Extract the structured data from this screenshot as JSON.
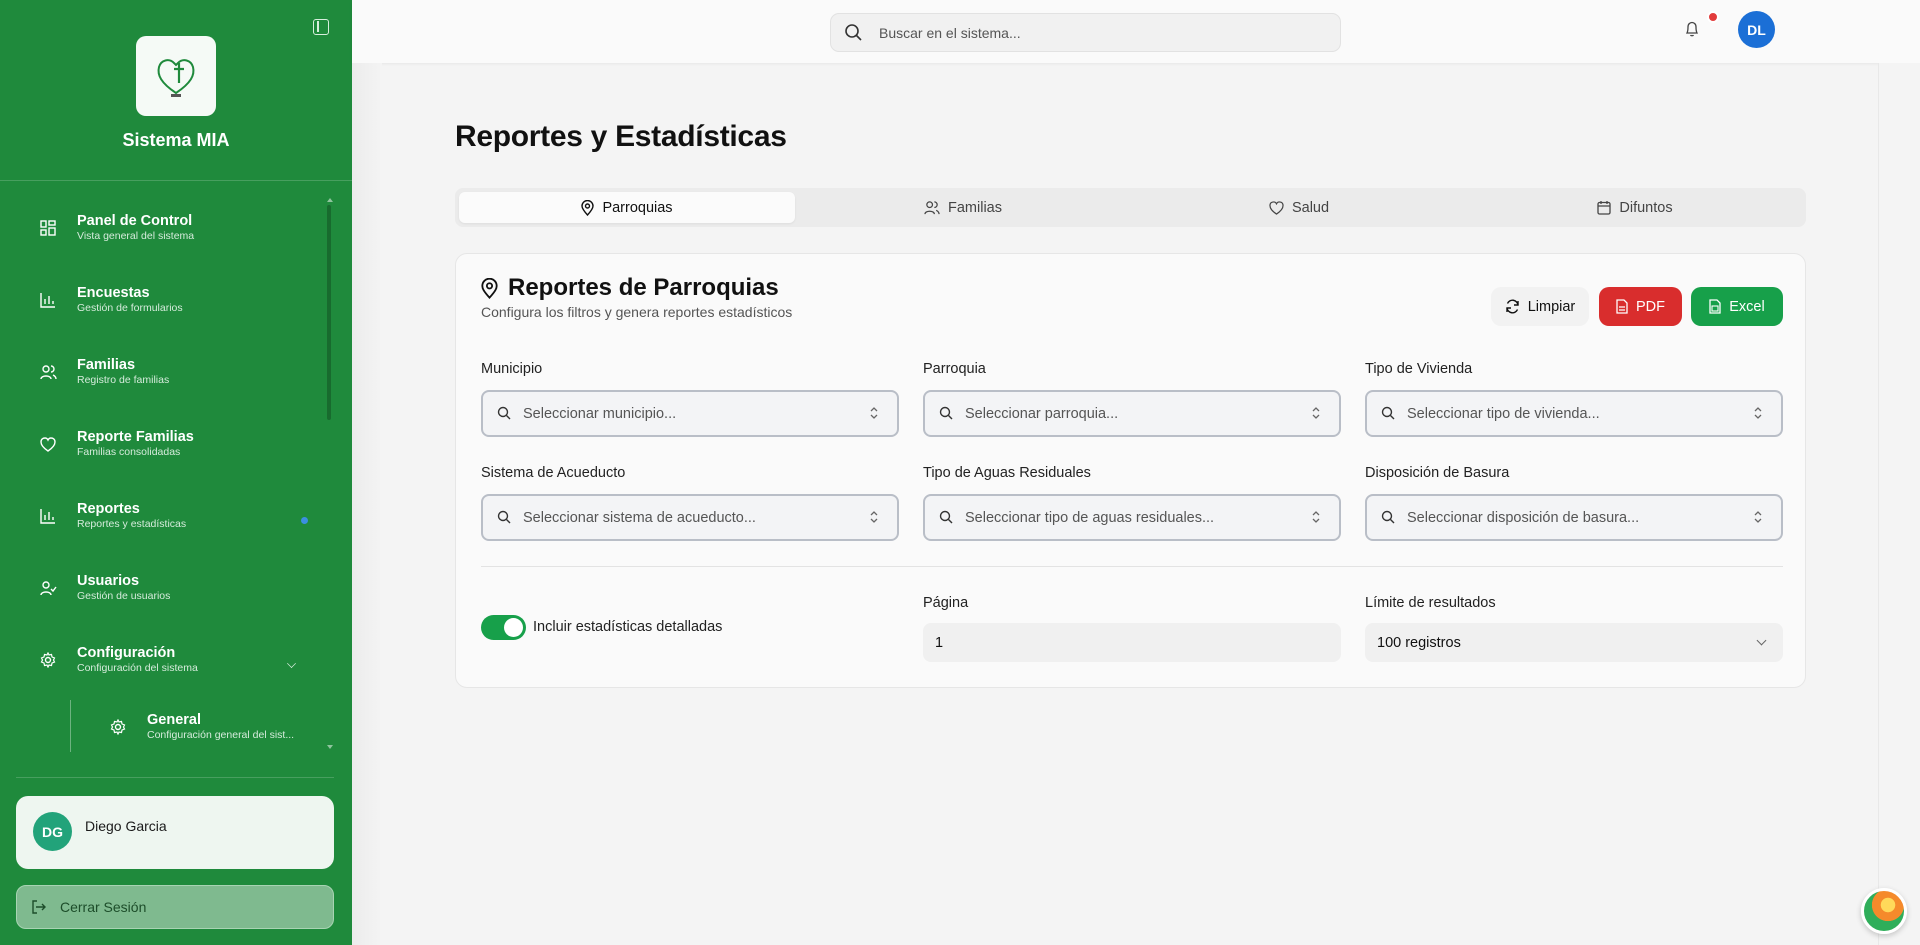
{
  "app": {
    "brand": "Sistema MIA"
  },
  "sidebar": {
    "items": [
      {
        "label": "Panel de Control",
        "sub": "Vista general del sistema",
        "icon": "dashboard-icon"
      },
      {
        "label": "Encuestas",
        "sub": "Gestión de formularios",
        "icon": "bar-chart-icon"
      },
      {
        "label": "Familias",
        "sub": "Registro de familias",
        "icon": "users-icon"
      },
      {
        "label": "Reporte Familias",
        "sub": "Familias consolidadas",
        "icon": "heart-icon"
      },
      {
        "label": "Reportes",
        "sub": "Reportes y estadísticas",
        "icon": "bar-chart-icon"
      },
      {
        "label": "Usuarios",
        "sub": "Gestión de usuarios",
        "icon": "user-check-icon"
      },
      {
        "label": "Configuración",
        "sub": "Configuración del sistema",
        "icon": "gear-icon"
      }
    ],
    "subitem": {
      "label": "General",
      "sub": "Configuración general del sist...",
      "icon": "gear-icon"
    },
    "user": {
      "initials": "DG",
      "name": "Diego Garcia"
    },
    "logout_label": "Cerrar Sesión"
  },
  "topbar": {
    "search_placeholder": "Buscar en el sistema...",
    "avatar_initials": "DL"
  },
  "main": {
    "title": "Reportes y Estadísticas",
    "tabs": [
      {
        "label": "Parroquias",
        "icon": "map-pin-icon"
      },
      {
        "label": "Familias",
        "icon": "users-icon"
      },
      {
        "label": "Salud",
        "icon": "heart-icon"
      },
      {
        "label": "Difuntos",
        "icon": "calendar-icon"
      }
    ],
    "card": {
      "title": "Reportes de Parroquias",
      "subtitle": "Configura los filtros y genera reportes estadísticos",
      "buttons": {
        "clear": "Limpiar",
        "pdf": "PDF",
        "excel": "Excel"
      },
      "filters": [
        {
          "label": "Municipio",
          "placeholder": "Seleccionar municipio..."
        },
        {
          "label": "Parroquia",
          "placeholder": "Seleccionar parroquia..."
        },
        {
          "label": "Tipo de Vivienda",
          "placeholder": "Seleccionar tipo de vivienda..."
        },
        {
          "label": "Sistema de Acueducto",
          "placeholder": "Seleccionar sistema de acueducto..."
        },
        {
          "label": "Tipo de Aguas Residuales",
          "placeholder": "Seleccionar tipo de aguas residuales..."
        },
        {
          "label": "Disposición de Basura",
          "placeholder": "Seleccionar disposición de basura..."
        }
      ],
      "toggle_label": "Incluir estadísticas detalladas",
      "toggle_on": true,
      "page_label": "Página",
      "page_value": "1",
      "limit_label": "Límite de resultados",
      "limit_value": "100 registros"
    }
  },
  "colors": {
    "sidebar": "#1f8a3c",
    "pdf": "#d92d2d",
    "excel": "#17a04a",
    "avatar": "#1b6fd6"
  }
}
